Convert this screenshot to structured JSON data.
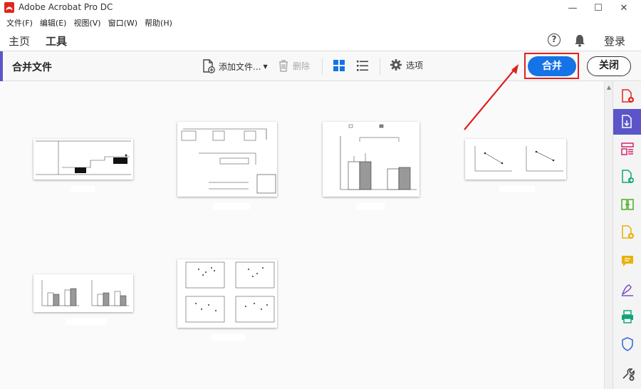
{
  "window": {
    "title": "Adobe Acrobat Pro DC",
    "minimize": "—",
    "maximize": "☐",
    "close": "✕"
  },
  "menu": [
    "文件(F)",
    "编辑(E)",
    "视图(V)",
    "窗口(W)",
    "帮助(H)"
  ],
  "nav": {
    "home": "主页",
    "tools": "工具",
    "help": "?",
    "login": "登录"
  },
  "toolbar": {
    "title": "合并文件",
    "add_files": "添加文件...",
    "delete": "删除",
    "options": "选项",
    "merge": "合并",
    "close": "关闭"
  },
  "colors": {
    "accent": "#5b55c9",
    "primary_button": "#1473e6",
    "highlight": "#e02020"
  },
  "rail_icons": [
    "create-pdf-icon",
    "export-pdf-icon",
    "organize-pages-icon",
    "send-for-review-icon",
    "compare-files-icon",
    "edit-pdf-icon",
    "comment-icon",
    "fill-sign-icon",
    "print-production-icon",
    "protect-icon",
    "more-tools-icon"
  ]
}
